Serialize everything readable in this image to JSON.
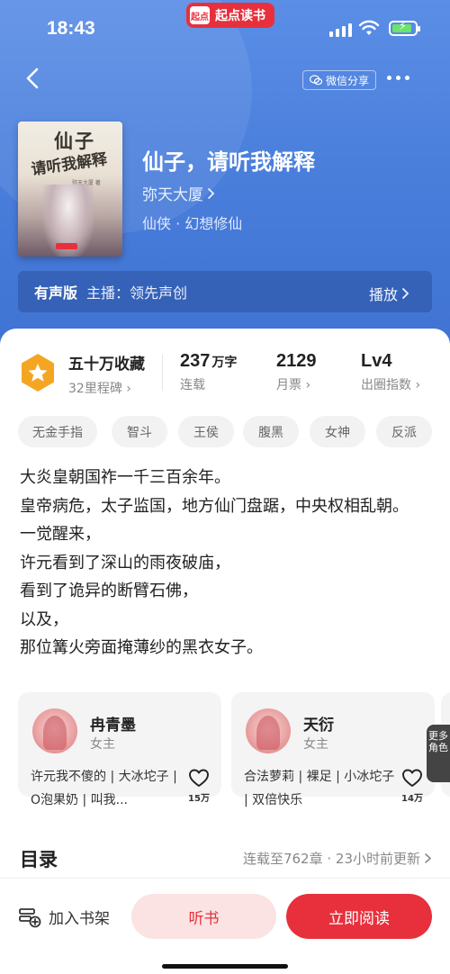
{
  "status": {
    "time": "18:43",
    "app_badge": "起点读书",
    "app_logo": "起点"
  },
  "nav": {
    "share_label": "微信分享"
  },
  "book": {
    "title": "仙子，请听我解释",
    "author": "弥天大厦",
    "genre": "仙侠 · 幻想修仙",
    "cover_title_1": "仙子",
    "cover_title_2": "请听我解释",
    "cover_author": "弥天大厦 著"
  },
  "audio": {
    "label": "有声版",
    "narrator": "主播：领先声创",
    "play_label": "播放"
  },
  "stats": {
    "collect": "五十万收藏",
    "milestones": "32里程碑",
    "words_value": "237",
    "words_unit": "万字",
    "words_sub": "连载",
    "tickets_value": "2129",
    "tickets_sub": "月票",
    "level_value": "Lv4",
    "level_sub": "出圈指数"
  },
  "tags": [
    "无金手指",
    "智斗",
    "王侯",
    "腹黑",
    "女神",
    "反派"
  ],
  "description": [
    "大炎皇朝国祚一千三百余年。",
    "皇帝病危，太子监国，地方仙门盘踞，中央权相乱朝。",
    "一觉醒来，",
    "许元看到了深山的雨夜破庙，",
    "看到了诡异的断臂石佛，",
    "以及，",
    "那位篝火旁面掩薄纱的黑衣女子。"
  ],
  "characters": [
    {
      "name": "冉青墨",
      "role": "女主",
      "tags": "许元我不傻的 | 大冰坨子 | O泡果奶 | 叫我...",
      "likes": "15万"
    },
    {
      "name": "天衍",
      "role": "女主",
      "tags": "合法萝莉 | 裸足 | 小冰坨子 | 双倍快乐",
      "likes": "14万"
    }
  ],
  "more_roles_label": "更多角色",
  "toc": {
    "title": "目录",
    "update": "连载至762章 · 23小时前更新"
  },
  "bottom": {
    "shelf_label": "加入书架",
    "listen_label": "听书",
    "read_label": "立即阅读"
  },
  "colors": {
    "brand_red": "#e8303d",
    "hero_blue": "#4a7fdc"
  }
}
